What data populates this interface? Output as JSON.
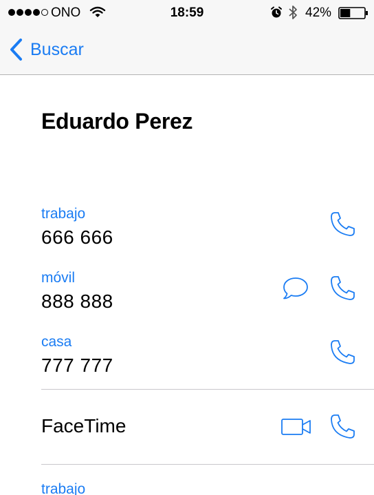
{
  "status_bar": {
    "carrier": "ONO",
    "signal_strength": 4,
    "signal_max": 5,
    "time": "18:59",
    "battery_percent": "42%",
    "battery_level": 0.42,
    "icons": [
      "signal-dots-icon",
      "wifi-icon",
      "alarm-icon",
      "bluetooth-icon",
      "battery-icon"
    ]
  },
  "nav": {
    "back_label": "Buscar",
    "back_icon": "chevron-left-icon"
  },
  "contact": {
    "name": "Eduardo Perez",
    "phones": [
      {
        "label": "trabajo",
        "number": "666 666",
        "actions": [
          "call"
        ]
      },
      {
        "label": "móvil",
        "number": "888 888",
        "actions": [
          "message",
          "call"
        ]
      },
      {
        "label": "casa",
        "number": "777 777",
        "actions": [
          "call"
        ]
      }
    ],
    "facetime_label": "FaceTime",
    "next_section_label": "trabajo"
  },
  "colors": {
    "accent": "#1a7cf3",
    "bar_background": "#f7f7f7",
    "divider": "#c8c7cc"
  }
}
